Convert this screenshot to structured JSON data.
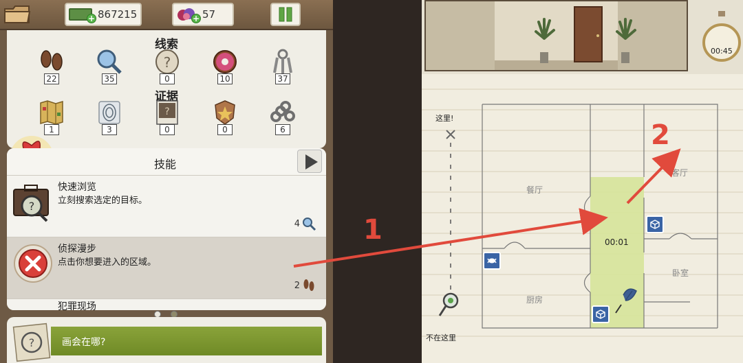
{
  "hud": {
    "money": "867215",
    "gems": "57",
    "plus": "+"
  },
  "clues": {
    "title": "线索",
    "items": [
      {
        "icon": "footprints-icon",
        "count": "22"
      },
      {
        "icon": "magnifier-icon",
        "count": "35"
      },
      {
        "icon": "question-stone-icon",
        "count": "0"
      },
      {
        "icon": "donut-icon",
        "count": "10"
      },
      {
        "icon": "keys-icon",
        "count": "37"
      }
    ]
  },
  "evidence": {
    "title": "证据",
    "items": [
      {
        "icon": "map-icon",
        "count": "1"
      },
      {
        "icon": "fingerprint-icon",
        "count": "3"
      },
      {
        "icon": "photo-icon",
        "count": "0"
      },
      {
        "icon": "badge-icon",
        "count": "0"
      },
      {
        "icon": "brass-knuckles-icon",
        "count": "6"
      }
    ]
  },
  "skills": {
    "title": "技能",
    "list": [
      {
        "name": "快速浏览",
        "desc": "立刻搜索选定的目标。",
        "cost": "4"
      },
      {
        "name": "侦探漫步",
        "desc": "点击你想要进入的区域。",
        "cost": "2"
      },
      {
        "name": "犯罪现场",
        "desc": ""
      }
    ]
  },
  "task": {
    "text": "画会在哪?"
  },
  "map": {
    "timer": "00:45",
    "here_label": "这里!",
    "not_here_label": "不在这里",
    "rooms": {
      "dining": "餐厅",
      "living": "客厅",
      "bedroom": "卧室",
      "kitchen": "厨房"
    },
    "progress_time": "00:01"
  },
  "annotations": {
    "label_1": "1",
    "label_2": "2"
  },
  "colors": {
    "arrow_red": "#e14a3c",
    "task_green": "#7f9a32",
    "zone_green": "#d6e39a",
    "marker_blue": "#3a64a5"
  }
}
